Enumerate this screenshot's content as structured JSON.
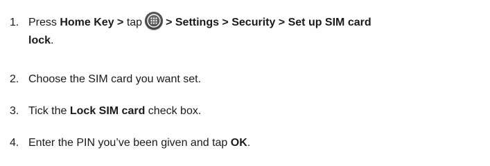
{
  "steps": [
    {
      "number": "1.",
      "text_press": "Press ",
      "bold_home": "Home Key >",
      "text_tap": " tap",
      "icon": "apps-grid-icon",
      "bold_path": "> Settings > Security > Set up SIM card",
      "bold_lock": "lock",
      "text_end": "."
    },
    {
      "number": "2.",
      "text": "Choose the SIM card you want set."
    },
    {
      "number": "3.",
      "text_before": "Tick the ",
      "bold": "Lock SIM card",
      "text_after": " check box."
    },
    {
      "number": "4.",
      "text_before": "Enter the PIN you’ve been given and tap ",
      "bold": "OK",
      "text_after": "."
    }
  ]
}
